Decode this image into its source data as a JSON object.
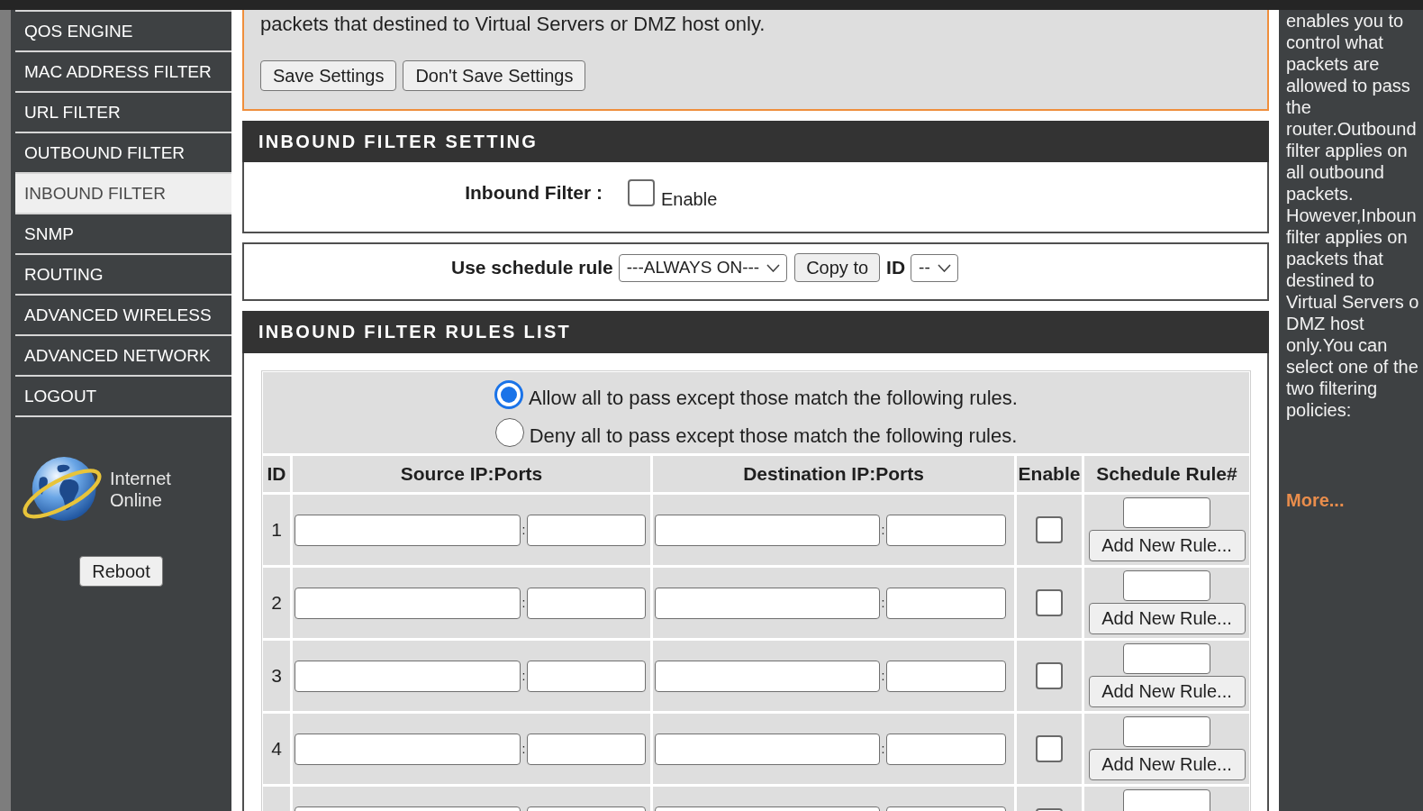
{
  "sidebar": {
    "items": [
      {
        "label": "QOS ENGINE",
        "selected": false
      },
      {
        "label": "MAC ADDRESS FILTER",
        "selected": false
      },
      {
        "label": "URL FILTER",
        "selected": false
      },
      {
        "label": "OUTBOUND FILTER",
        "selected": false
      },
      {
        "label": "INBOUND FILTER",
        "selected": true
      },
      {
        "label": "SNMP",
        "selected": false
      },
      {
        "label": "ROUTING",
        "selected": false
      },
      {
        "label": "ADVANCED WIRELESS",
        "selected": false
      },
      {
        "label": "ADVANCED NETWORK",
        "selected": false
      },
      {
        "label": "LOGOUT",
        "selected": false
      }
    ],
    "internet_status": [
      "Internet",
      "Online"
    ],
    "reboot_button": "Reboot"
  },
  "notice": {
    "text": "packets that destined to Virtual Servers or DMZ host only.",
    "buttons": [
      "Save Settings",
      "Don't Save Settings"
    ]
  },
  "inbound_filter_setting": {
    "title": "INBOUND FILTER SETTING",
    "label": "Inbound Filter :",
    "checked": false,
    "checkbox_label": "Enable"
  },
  "schedule": {
    "label": "Use schedule rule",
    "rule_select": "---ALWAYS ON---",
    "copy_button": "Copy to",
    "id_label": "ID",
    "id_select": "--"
  },
  "rules_list": {
    "title": "INBOUND FILTER RULES LIST",
    "policies": [
      {
        "label": "Allow all to pass except those match the following rules.",
        "selected": true
      },
      {
        "label": "Deny all to pass except those match the following rules.",
        "selected": false
      }
    ],
    "columns": [
      "ID",
      "Source IP:Ports",
      "Destination IP:Ports",
      "Enable",
      "Schedule Rule#"
    ],
    "rules": [
      {
        "id": "1",
        "source_separator": ":",
        "destination_separator": ":",
        "enabled": false,
        "button": "Add New Rule..."
      },
      {
        "id": "2",
        "source_separator": ":",
        "destination_separator": ":",
        "enabled": false,
        "button": "Add New Rule..."
      },
      {
        "id": "3",
        "source_separator": ":",
        "destination_separator": ":",
        "enabled": false,
        "button": "Add New Rule..."
      },
      {
        "id": "4",
        "source_separator": ":",
        "destination_separator": ":",
        "enabled": false,
        "button": "Add New Rule..."
      },
      {
        "enabled": false
      }
    ]
  },
  "help": {
    "text": "enables you to control what packets are allowed to pass the router.Outbound filter applies on all outbound packets. However,Inboun filter applies on packets that destined to Virtual Servers o DMZ host only.You can select one of the two filtering policies:",
    "more_link": "More..."
  }
}
